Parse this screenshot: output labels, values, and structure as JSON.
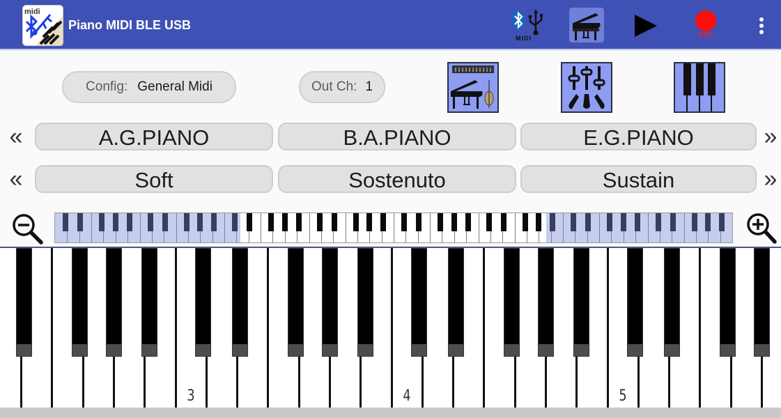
{
  "app": {
    "title": "Piano MIDI BLE USB",
    "icon": "app-logo-midi-piano-icon"
  },
  "toolbar": {
    "actions": [
      {
        "name": "bluetooth-usb-midi-icon",
        "label": "MIDI"
      },
      {
        "name": "grand-piano-icon",
        "selected": true
      },
      {
        "name": "play-icon"
      },
      {
        "name": "record-icon",
        "label": "REC"
      },
      {
        "name": "overflow-menu-icon"
      }
    ],
    "midi_label": "MIDI",
    "rec_label": "REC",
    "colors": {
      "bar": "#3f51b5",
      "selected": "#6f80d9",
      "record": "#ff1a1a"
    }
  },
  "config": {
    "label": "Config:",
    "value": "General Midi"
  },
  "out_channel": {
    "label": "Out Ch:",
    "value": "1"
  },
  "mode_buttons": [
    {
      "name": "instrument-sound-icon"
    },
    {
      "name": "mixer-pedals-icon"
    },
    {
      "name": "keys-layout-icon"
    }
  ],
  "instruments": {
    "prev": "«",
    "next": "»",
    "items": [
      "A.G.PIANO",
      "B.A.PIANO",
      "E.G.PIANO"
    ]
  },
  "pedals": {
    "prev": "«",
    "next": "»",
    "items": [
      "Soft",
      "Sostenuto",
      "Sustain"
    ]
  },
  "overview": {
    "first_note": "C0",
    "octaves": 8,
    "white_keys": 56,
    "view_start_white_key": 15.31,
    "view_end_white_key": 40.62
  },
  "keyboard": {
    "first_visible_note": "D2",
    "last_visible_note": "A5",
    "octave_labels": [
      {
        "note": "C3",
        "label": "3"
      },
      {
        "note": "C4",
        "label": "4"
      },
      {
        "note": "C5",
        "label": "5"
      }
    ]
  }
}
